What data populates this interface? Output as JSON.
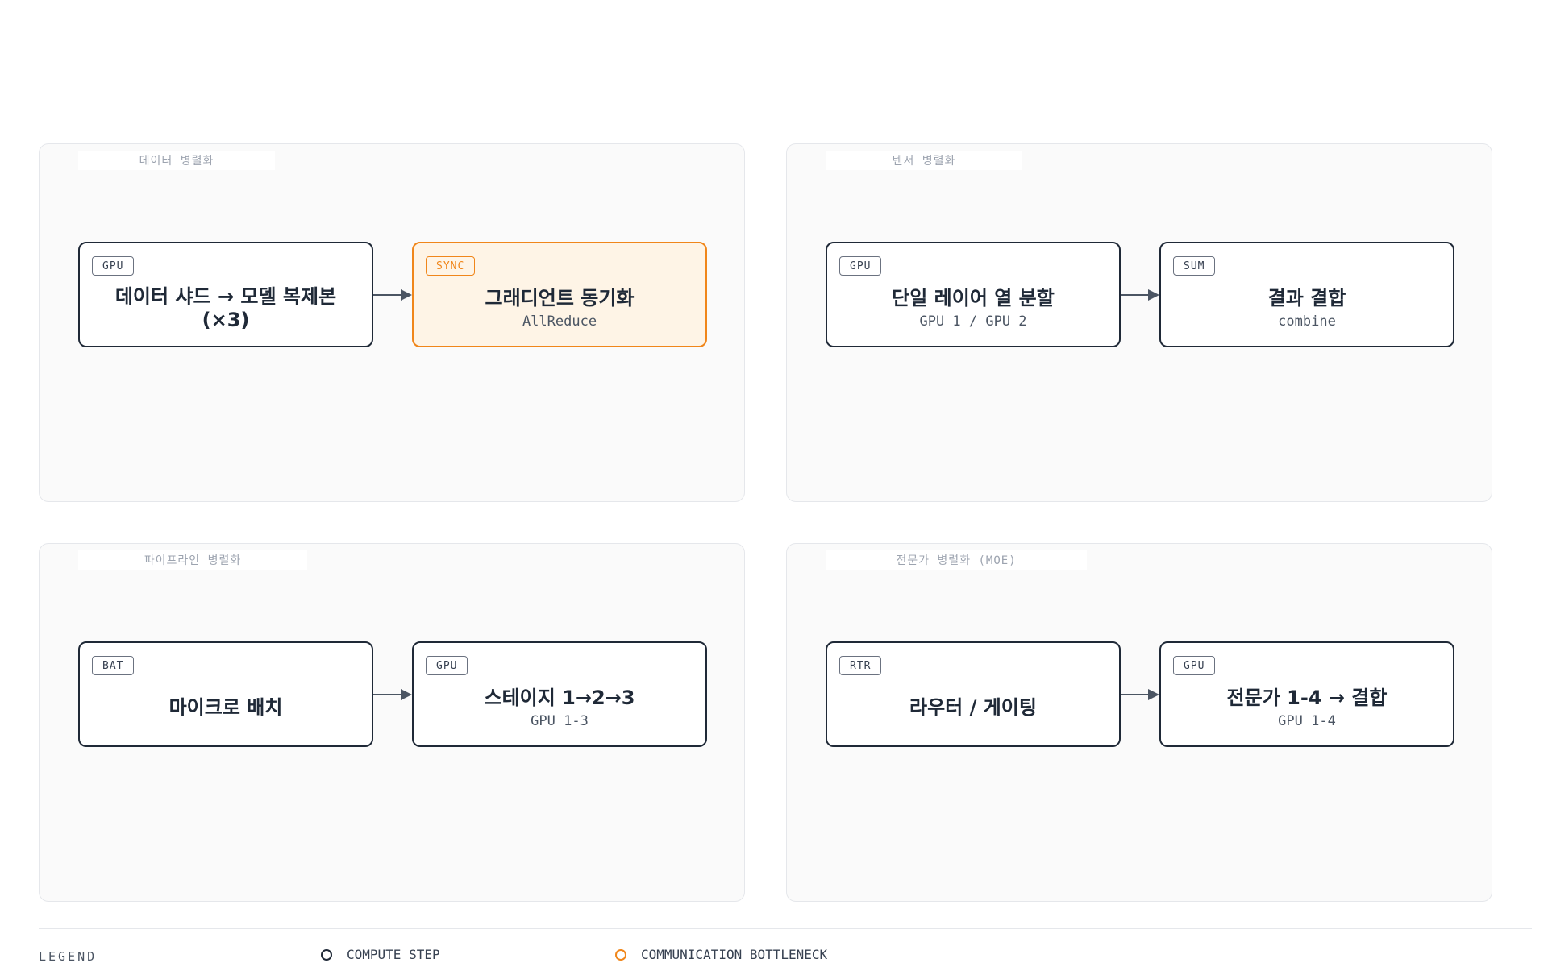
{
  "panels": [
    {
      "label": "데이터 병렬화",
      "nodes": [
        {
          "tag": "GPU",
          "title": "데이터 샤드 → 모델 복제본 (×3)",
          "subtitle": ""
        },
        {
          "tag": "SYNC",
          "title": "그래디언트 동기화",
          "subtitle": "AllReduce"
        }
      ]
    },
    {
      "label": "텐서 병렬화",
      "nodes": [
        {
          "tag": "GPU",
          "title": "단일 레이어 열 분할",
          "subtitle": "GPU 1 / GPU 2"
        },
        {
          "tag": "SUM",
          "title": "결과 결합",
          "subtitle": "combine"
        }
      ]
    },
    {
      "label": "파이프라인 병렬화",
      "nodes": [
        {
          "tag": "BAT",
          "title": "마이크로 배치",
          "subtitle": ""
        },
        {
          "tag": "GPU",
          "title": "스테이지 1→2→3",
          "subtitle": "GPU 1-3"
        }
      ]
    },
    {
      "label": "전문가 병렬화 (MOE)",
      "nodes": [
        {
          "tag": "RTR",
          "title": "라우터 / 게이팅",
          "subtitle": ""
        },
        {
          "tag": "GPU",
          "title": "전문가 1-4 → 결합",
          "subtitle": "GPU 1-4"
        }
      ]
    }
  ],
  "legend": {
    "title": "LEGEND",
    "items": [
      {
        "label": "COMPUTE STEP"
      },
      {
        "label": "COMMUNICATION BOTTLENECK"
      }
    ]
  },
  "colors": {
    "compute_border": "#1f2937",
    "bottleneck_accent": "#f0861a",
    "bottleneck_fill": "#fef4e6",
    "panel_fill": "#fafafa",
    "arrow": "#4b5563"
  }
}
